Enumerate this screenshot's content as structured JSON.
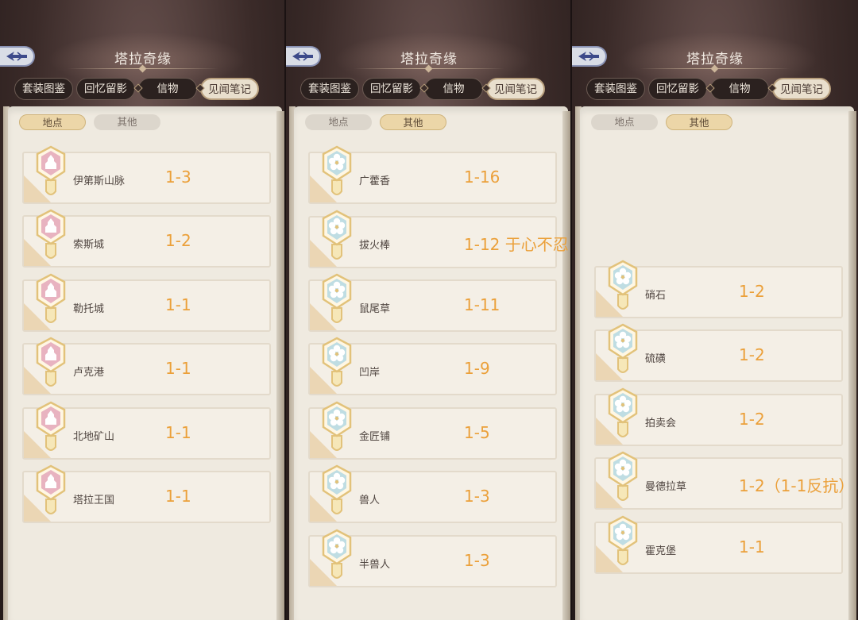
{
  "panels": [
    {
      "title": "塔拉奇缘",
      "tabs": [
        "套装图鉴",
        "回忆留影",
        "信物",
        "见闻笔记"
      ],
      "active_tab": 3,
      "subtabs": [
        "地点",
        "其他"
      ],
      "active_subtab": 0,
      "badge_style": "pink",
      "rows": [
        {
          "name": "伊第斯山脉",
          "value": "1-3"
        },
        {
          "name": "索斯城",
          "value": "1-2"
        },
        {
          "name": "勒托城",
          "value": "1-1"
        },
        {
          "name": "卢克港",
          "value": "1-1"
        },
        {
          "name": "北地矿山",
          "value": "1-1"
        },
        {
          "name": "塔拉王国",
          "value": "1-1"
        }
      ]
    },
    {
      "title": "塔拉奇缘",
      "tabs": [
        "套装图鉴",
        "回忆留影",
        "信物",
        "见闻笔记"
      ],
      "active_tab": 3,
      "subtabs": [
        "地点",
        "其他"
      ],
      "active_subtab": 1,
      "badge_style": "teal",
      "rows": [
        {
          "name": "广藿香",
          "value": "1-16"
        },
        {
          "name": "拔火棒",
          "value": "1-12 于心不忍"
        },
        {
          "name": "鼠尾草",
          "value": "1-11"
        },
        {
          "name": "凹岸",
          "value": "1-9"
        },
        {
          "name": "金匠铺",
          "value": "1-5"
        },
        {
          "name": "兽人",
          "value": "1-3"
        },
        {
          "name": "半兽人",
          "value": "1-3"
        }
      ]
    },
    {
      "title": "塔拉奇缘",
      "tabs": [
        "套装图鉴",
        "回忆留影",
        "信物",
        "见闻笔记"
      ],
      "active_tab": 3,
      "subtabs": [
        "地点",
        "其他"
      ],
      "active_subtab": 1,
      "badge_style": "teal",
      "rows": [
        {
          "name": "硝石",
          "value": "1-2"
        },
        {
          "name": "硫磺",
          "value": "1-2"
        },
        {
          "name": "拍卖会",
          "value": "1-2"
        },
        {
          "name": "曼德拉草",
          "value": "1-2（1-1反抗）"
        },
        {
          "name": "霍克堡",
          "value": "1-1"
        }
      ]
    }
  ],
  "colors": {
    "accent_value": "#eba03a",
    "badge_pink": "#e8b3c0",
    "badge_teal": "#bfdde3",
    "badge_gold": "#e2c27a"
  },
  "icons": {
    "back": "back-arrow-icon",
    "pink_badge": "location-badge-icon",
    "teal_badge": "flower-badge-icon"
  }
}
